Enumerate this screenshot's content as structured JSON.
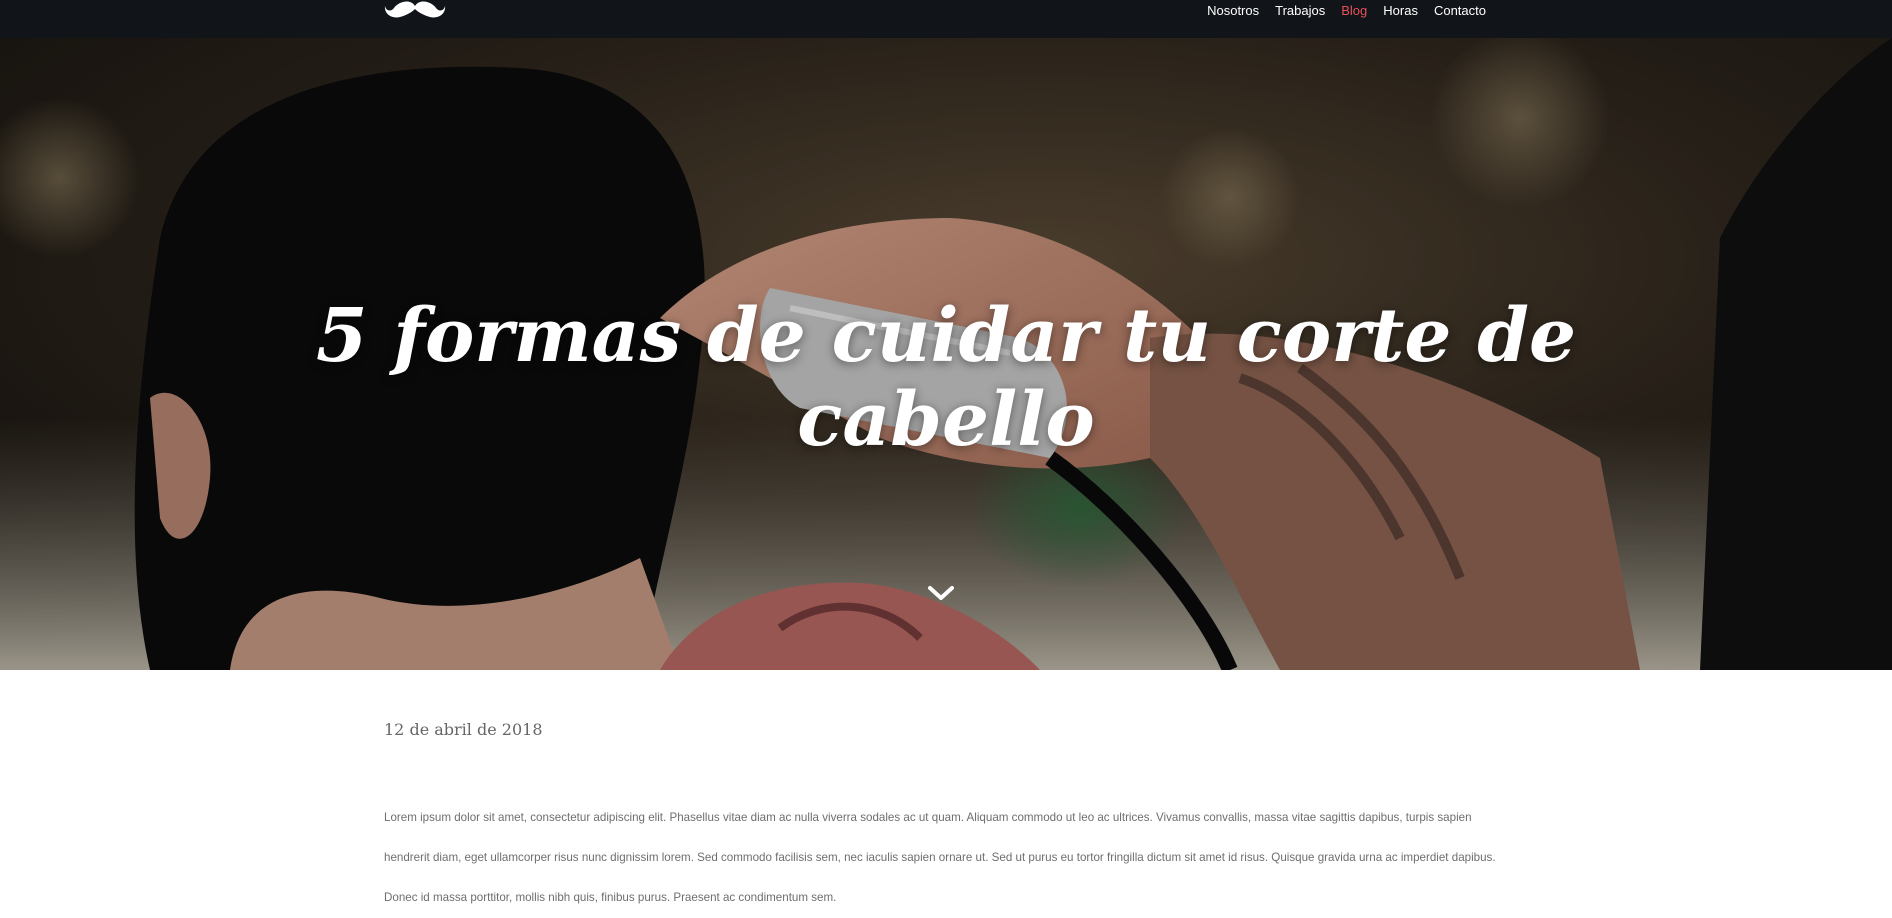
{
  "nav": {
    "logo_icon": "mustache-icon",
    "links": [
      {
        "label": "Nosotros",
        "active": false
      },
      {
        "label": "Trabajos",
        "active": false
      },
      {
        "label": "Blog",
        "active": true
      },
      {
        "label": "Horas",
        "active": false
      },
      {
        "label": "Contacto",
        "active": false
      }
    ]
  },
  "hero": {
    "title_line1": "5 formas de cuidar tu corte de",
    "title_line2": "cabello",
    "scroll_icon": "chevron-down-icon"
  },
  "post": {
    "date": "12 de abril de 2018",
    "body": "Lorem ipsum dolor sit amet, consectetur adipiscing elit. Phasellus vitae diam ac nulla viverra sodales ac ut quam. Aliquam commodo ut leo ac ultrices. Vivamus convallis, massa vitae sagittis dapibus, turpis sapien hendrerit diam, eget ullamcorper risus nunc dignissim lorem. Sed commodo facilisis sem, nec iaculis sapien ornare ut. Sed ut purus eu tortor fringilla dictum sit amet id risus. Quisque gravida urna ac imperdiet dapibus. Donec id massa porttitor, mollis nibh quis, finibus purus. Praesent ac condimentum sem."
  },
  "colors": {
    "nav_bg": "#111418",
    "accent": "#e8505b",
    "text_muted": "#6e6e6e"
  }
}
